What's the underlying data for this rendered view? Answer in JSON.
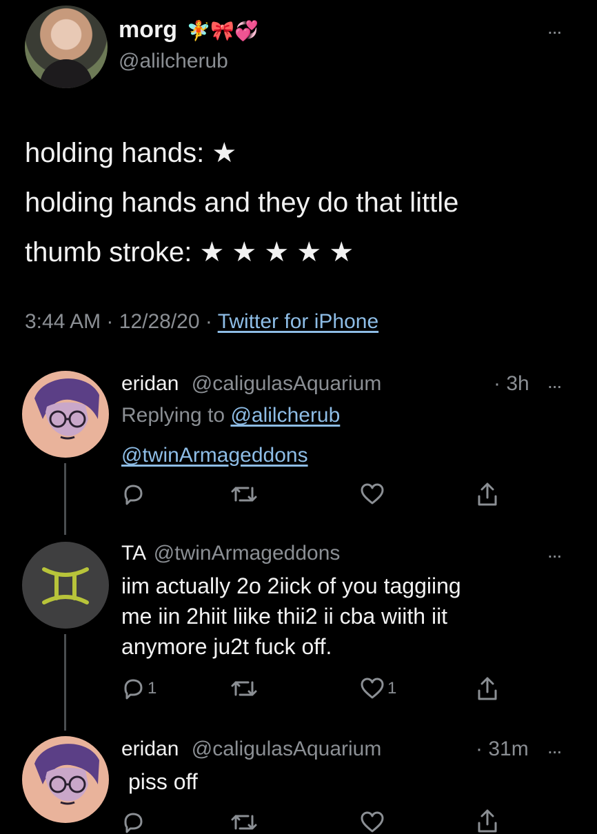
{
  "tweet": {
    "display_name": "morg",
    "name_emojis": "🧚🎀💞",
    "handle": "@alilcherub",
    "more": "...",
    "text_line1": "holding hands: ★",
    "text_line2": "holding hands and they do that little",
    "text_line3": "thumb stroke: ★ ★ ★ ★ ★",
    "time": "3:44 AM",
    "sep1": "·",
    "date": "12/28/20",
    "sep2": "·",
    "source": "Twitter for iPhone"
  },
  "replies": [
    {
      "name": "eridan",
      "handle": "@caligulasAquarium",
      "time": "· 3h",
      "more": "...",
      "replying_prefix": "Replying to",
      "replying_to": "@alilcherub",
      "body": "@twinArmageddons",
      "reply_count": "",
      "like_count": ""
    },
    {
      "name": "TA",
      "handle": "@twinArmageddons",
      "more": "...",
      "body_line1": "iim actually 2o 2iick of you taggiing",
      "body_line2": "me iin 2hiit liike thii2 ii cba wiith iit",
      "body_line3": "anymore ju2t fuck off.",
      "reply_count": "1",
      "like_count": "1"
    },
    {
      "name": "eridan",
      "handle": "@caligulasAquarium",
      "time": "· 31m",
      "more": "...",
      "body": "piss off"
    }
  ],
  "colors": {
    "background": "#000000",
    "text": "#e7e9ea",
    "muted": "#8b8f94",
    "link": "#8ebde6",
    "gemini_symbol": "#b8c43a"
  },
  "icons": [
    "reply-icon",
    "retweet-icon",
    "like-icon",
    "share-icon",
    "gemini-icon"
  ]
}
